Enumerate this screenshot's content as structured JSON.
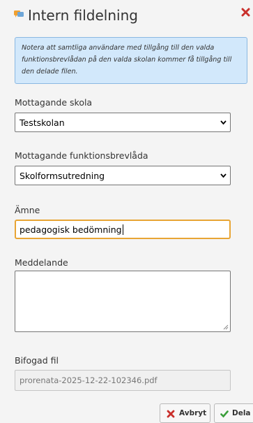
{
  "dialog": {
    "title": "Intern fildelning",
    "title_icon": "comment-icon",
    "close_icon": "close-icon"
  },
  "notice": {
    "text": "Notera att samtliga användare med tillgång till den valda funktionsbrevlådan på den valda skolan kommer få tillgång till den delade filen."
  },
  "fields": {
    "school": {
      "label": "Mottagande skola",
      "value": "Testskolan"
    },
    "mailbox": {
      "label": "Mottagande funktionsbrevlåda",
      "value": "Skolformsutredning"
    },
    "subject": {
      "label": "Ämne",
      "value": "pedagogisk bedömning"
    },
    "message": {
      "label": "Meddelande",
      "value": ""
    },
    "attachment": {
      "label": "Bifogad fil",
      "value": "prorenata-2025-12-22-102346.pdf"
    }
  },
  "buttons": {
    "cancel": {
      "label": "Avbryt",
      "icon": "close-icon"
    },
    "share": {
      "label": "Dela",
      "icon": "check-icon"
    }
  },
  "colors": {
    "notice_bg": "#d2e8fb",
    "notice_border": "#8ab8e2",
    "focus_border": "#e8a534",
    "close_red": "#c9302c",
    "check_green": "#3a9e3a",
    "title_icon_orange": "#f0a030"
  }
}
